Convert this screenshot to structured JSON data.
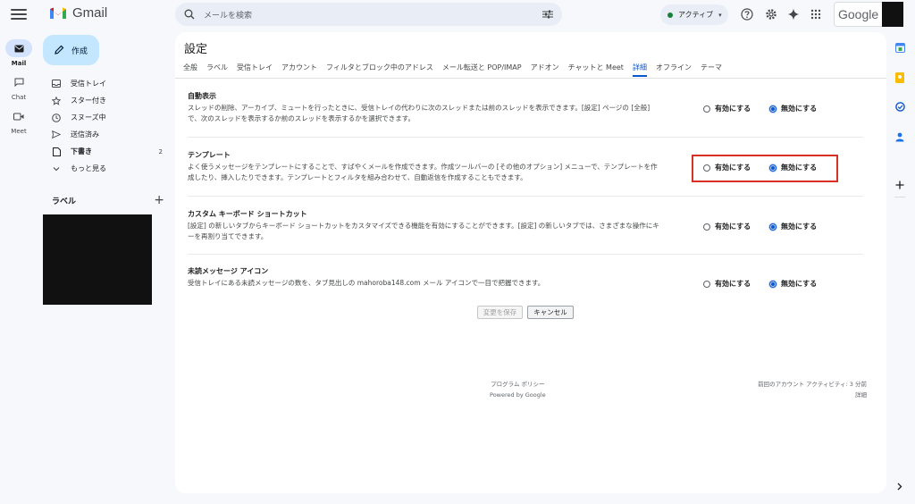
{
  "app": {
    "name": "Gmail"
  },
  "rail": [
    {
      "label": "Mail",
      "icon": "mail-icon"
    },
    {
      "label": "Chat",
      "icon": "chat-icon"
    },
    {
      "label": "Meet",
      "icon": "meet-icon"
    }
  ],
  "compose": {
    "label": "作成"
  },
  "nav": [
    {
      "label": "受信トレイ",
      "icon": "inbox-icon",
      "count": ""
    },
    {
      "label": "スター付き",
      "icon": "star-icon",
      "count": ""
    },
    {
      "label": "スヌーズ中",
      "icon": "clock-icon",
      "count": ""
    },
    {
      "label": "送信済み",
      "icon": "send-icon",
      "count": ""
    },
    {
      "label": "下書き",
      "icon": "draft-icon",
      "count": "2"
    },
    {
      "label": "もっと見る",
      "icon": "chevron-down-icon",
      "count": ""
    }
  ],
  "labels": {
    "header": "ラベル",
    "add": "+"
  },
  "search": {
    "placeholder": "メールを検索"
  },
  "status": {
    "label": "アクティブ",
    "color": "#188038"
  },
  "google": {
    "label": "Google"
  },
  "settings": {
    "title": "設定",
    "tabs": [
      "全般",
      "ラベル",
      "受信トレイ",
      "アカウント",
      "フィルタとブロック中のアドレス",
      "メール転送と POP/IMAP",
      "アドオン",
      "チャットと Meet",
      "詳細",
      "オフライン",
      "テーマ"
    ],
    "active_tab": "詳細",
    "enable_label": "有効にする",
    "disable_label": "無効にする",
    "items": [
      {
        "title": "自動表示",
        "desc": "スレッドの削除、アーカイブ、ミュートを行ったときに、受信トレイの代わりに次のスレッドまたは前のスレッドを表示できます。[設定] ページの [全般] で、次のスレッドを表示するか前のスレッドを表示するかを選択できます。",
        "selected": "disable"
      },
      {
        "title": "テンプレート",
        "desc": "よく使うメッセージをテンプレートにすることで、すばやくメールを作成できます。作成ツールバーの [その他のオプション] メニューで、テンプレートを作成したり、挿入したりできます。テンプレートとフィルタを組み合わせて、自動返信を作成することもできます。",
        "selected": "disable"
      },
      {
        "title": "カスタム キーボード ショートカット",
        "desc": "[設定] の新しいタブからキーボード ショートカットをカスタマイズできる機能を有効にすることができます。[設定] の新しいタブでは、さまざまな操作にキーを再割り当てできます。",
        "selected": "disable"
      },
      {
        "title": "未読メッセージ アイコン",
        "desc": "受信トレイにある未読メッセージの数を、タブ見出しの mahoroba148.com メール アイコンで一目で把握できます。",
        "selected": "disable"
      }
    ],
    "save_label": "変更を保存",
    "cancel_label": "キャンセル"
  },
  "footer": {
    "policy": "プログラム ポリシー",
    "powered": "Powered by Google",
    "activity": "前回のアカウント アクティビティ: 3 分前",
    "details": "詳細"
  },
  "colors": {
    "accent": "#0b57d0",
    "compose_bg": "#c2e7ff",
    "highlight": "#d93025"
  }
}
